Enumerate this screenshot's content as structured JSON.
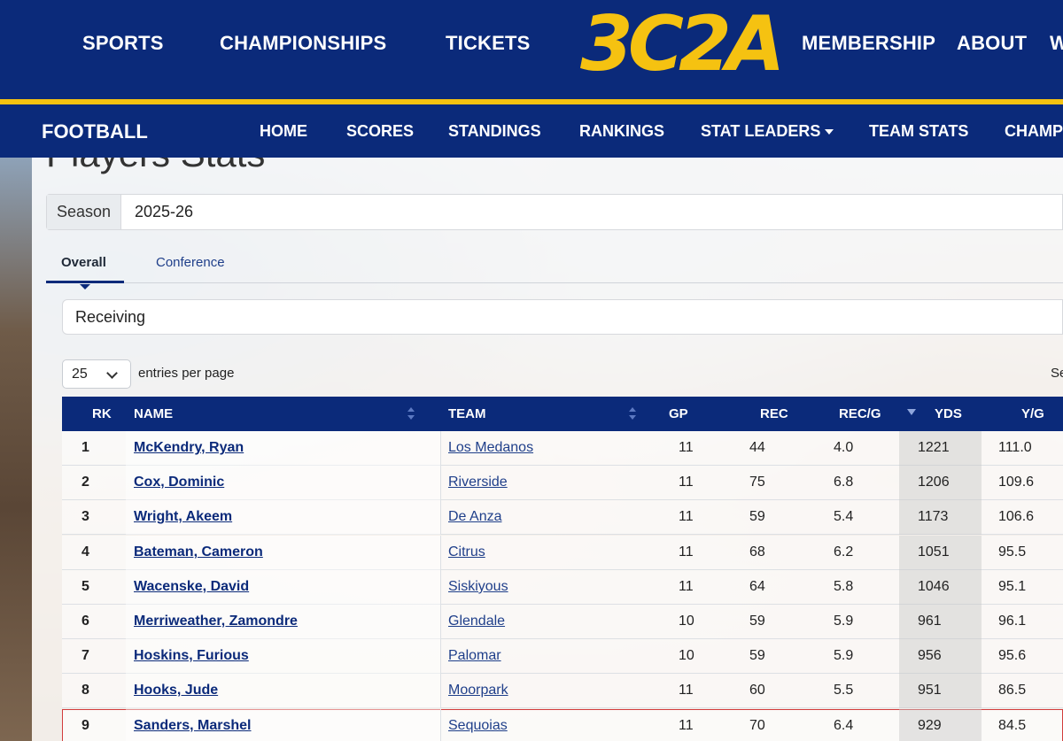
{
  "top_nav": {
    "items": [
      "SPORTS",
      "CHAMPIONSHIPS",
      "TICKETS",
      "MEMBERSHIP",
      "ABOUT",
      "W"
    ],
    "logo_text": "3C2A"
  },
  "sub_nav": {
    "brand": "FOOTBALL",
    "items": [
      "HOME",
      "SCORES",
      "STANDINGS",
      "RANKINGS",
      "STAT LEADERS",
      "TEAM STATS",
      "CHAMP"
    ]
  },
  "page": {
    "title": "Players Stats"
  },
  "season": {
    "label": "Season",
    "value": "2025-26"
  },
  "tabs": {
    "active": "Overall",
    "other": "Conference"
  },
  "category": {
    "value": "Receiving"
  },
  "entries": {
    "value": "25",
    "label": "entries per page",
    "search_label": "Se"
  },
  "table": {
    "headers": [
      "RK",
      "NAME",
      "TEAM",
      "GP",
      "REC",
      "REC/G",
      "YDS",
      "Y/G"
    ],
    "sorted_by": "YDS",
    "rows": [
      {
        "rk": "1",
        "name": "McKendry, Ryan",
        "team": "Los Medanos",
        "gp": "11",
        "rec": "44",
        "recg": "4.0",
        "yds": "1221",
        "yg": "111.0"
      },
      {
        "rk": "2",
        "name": "Cox, Dominic",
        "team": "Riverside",
        "gp": "11",
        "rec": "75",
        "recg": "6.8",
        "yds": "1206",
        "yg": "109.6"
      },
      {
        "rk": "3",
        "name": "Wright, Akeem",
        "team": "De Anza",
        "gp": "11",
        "rec": "59",
        "recg": "5.4",
        "yds": "1173",
        "yg": "106.6"
      },
      {
        "rk": "4",
        "name": "Bateman, Cameron",
        "team": "Citrus",
        "gp": "11",
        "rec": "68",
        "recg": "6.2",
        "yds": "1051",
        "yg": "95.5"
      },
      {
        "rk": "5",
        "name": "Wacenske, David",
        "team": "Siskiyous",
        "gp": "11",
        "rec": "64",
        "recg": "5.8",
        "yds": "1046",
        "yg": "95.1"
      },
      {
        "rk": "6",
        "name": "Merriweather, Zamondre",
        "team": "Glendale",
        "gp": "10",
        "rec": "59",
        "recg": "5.9",
        "yds": "961",
        "yg": "96.1"
      },
      {
        "rk": "7",
        "name": "Hoskins, Furious",
        "team": "Palomar",
        "gp": "10",
        "rec": "59",
        "recg": "5.9",
        "yds": "956",
        "yg": "95.6"
      },
      {
        "rk": "8",
        "name": "Hooks, Jude",
        "team": "Moorpark",
        "gp": "11",
        "rec": "60",
        "recg": "5.5",
        "yds": "951",
        "yg": "86.5"
      },
      {
        "rk": "9",
        "name": "Sanders, Marshel",
        "team": "Sequoias",
        "gp": "11",
        "rec": "70",
        "recg": "6.4",
        "yds": "929",
        "yg": "84.5"
      }
    ]
  },
  "colors": {
    "brand_navy": "#0b2a7a",
    "brand_gold": "#f5c211",
    "highlight_row_border": "#d23c3c"
  }
}
